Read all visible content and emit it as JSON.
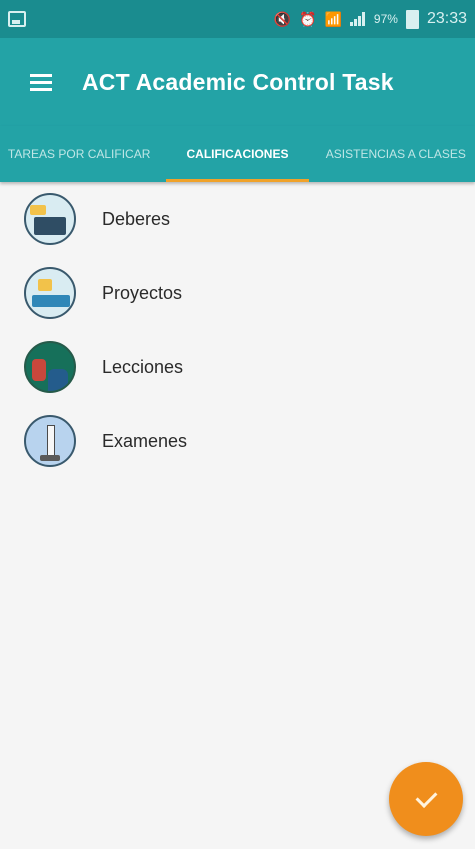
{
  "status_bar": {
    "battery": "97%",
    "time": "23:33",
    "icons": [
      "gallery-icon",
      "mute-icon",
      "alarm-icon",
      "wifi-icon",
      "signal-icon",
      "battery-icon"
    ]
  },
  "toolbar": {
    "title": "ACT Academic Control Task",
    "menu_icon": "menu-icon"
  },
  "tabs": [
    {
      "label": "TAREAS POR CALIFICAR",
      "active": false
    },
    {
      "label": "CALIFICACIONES",
      "active": true
    },
    {
      "label": "ASISTENCIAS A CLASES",
      "active": false
    }
  ],
  "list": {
    "items": [
      {
        "label": "Deberes",
        "icon": "homework-icon"
      },
      {
        "label": "Proyectos",
        "icon": "projects-icon"
      },
      {
        "label": "Lecciones",
        "icon": "lessons-icon"
      },
      {
        "label": "Examenes",
        "icon": "exams-icon"
      }
    ]
  },
  "fab": {
    "icon": "check-icon"
  },
  "colors": {
    "primary": "#23a3a6",
    "status_bar": "#1a8c8f",
    "tab_indicator": "#f0a22a",
    "fab": "#f08e1c",
    "background": "#f5f5f5"
  }
}
